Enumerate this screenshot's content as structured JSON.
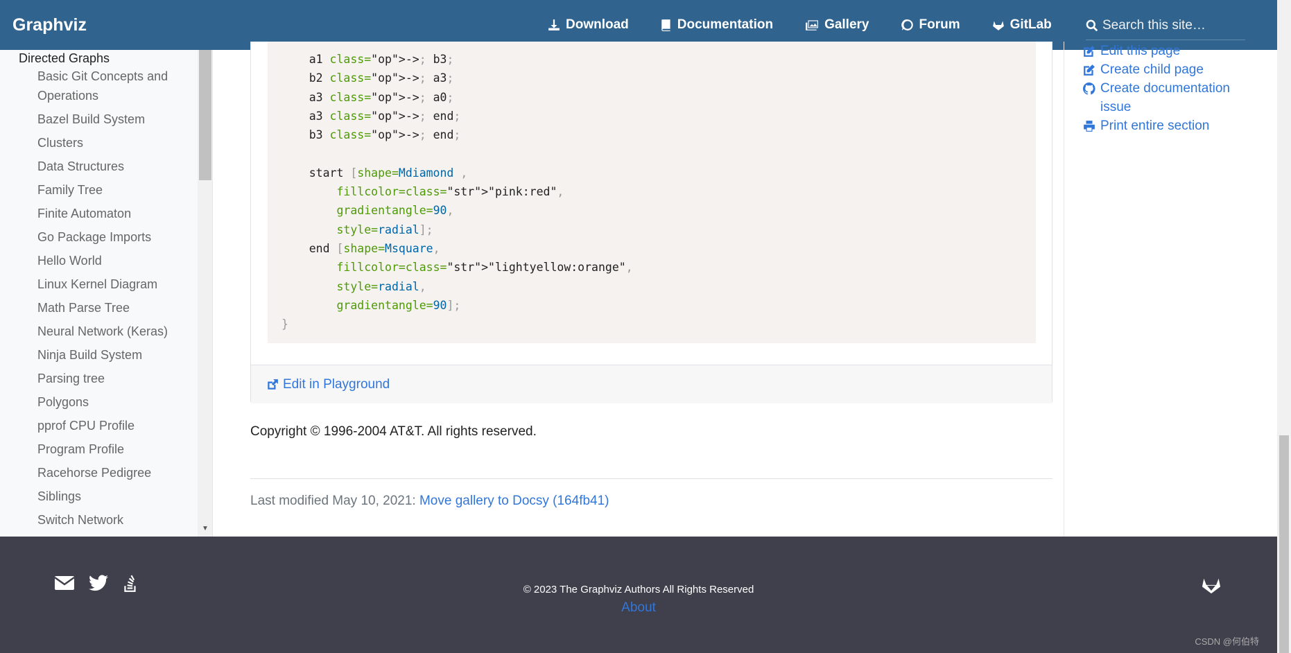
{
  "nav": {
    "brand": "Graphviz",
    "links": [
      "Download",
      "Documentation",
      "Gallery",
      "Forum",
      "GitLab"
    ],
    "search_placeholder": "Search this site…"
  },
  "sidebar": {
    "section": "Directed Graphs",
    "items": [
      "Basic Git Concepts and Operations",
      "Bazel Build System",
      "Clusters",
      "Data Structures",
      "Family Tree",
      "Finite Automaton",
      "Go Package Imports",
      "Hello World",
      "Linux Kernel Diagram",
      "Math Parse Tree",
      "Neural Network (Keras)",
      "Ninja Build System",
      "Parsing tree",
      "Polygons",
      "pprof CPU Profile",
      "Program Profile",
      "Racehorse Pedigree",
      "Siblings",
      "Switch Network"
    ]
  },
  "code": {
    "lines": [
      "    a1 -> b3;",
      "    b2 -> a3;",
      "    a3 -> a0;",
      "    a3 -> end;",
      "    b3 -> end;",
      "",
      "    start [shape=Mdiamond ,",
      "        fillcolor=\"pink:red\",",
      "        gradientangle=90,",
      "        style=radial];",
      "    end [shape=Msquare,",
      "        fillcolor=\"lightyellow:orange\",",
      "        style=radial,",
      "        gradientangle=90];",
      "}"
    ]
  },
  "card_footer": {
    "edit_label": "Edit in Playground"
  },
  "copyright": "Copyright © 1996-2004 AT&T. All rights reserved.",
  "last_modified": {
    "prefix": "Last modified May 10, 2021: ",
    "link": "Move gallery to Docsy (164fb41)"
  },
  "right_links": [
    "Edit this page",
    "Create child page",
    "Create documentation issue",
    "Print entire section"
  ],
  "footer": {
    "copyright": "© 2023 The Graphviz Authors All Rights Reserved",
    "about": "About",
    "watermark": "CSDN @何伯特"
  },
  "colors": {
    "navbar": "#30638e",
    "link": "#3176d9",
    "footer_bg": "#403f4c",
    "code_bg": "#f5f2ef"
  }
}
